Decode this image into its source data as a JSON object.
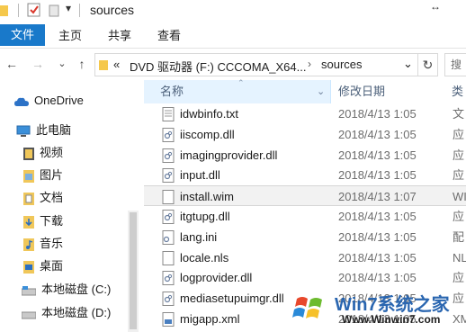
{
  "window": {
    "title": "sources",
    "resize_glyph": "↔"
  },
  "ribbon": {
    "tabs": [
      {
        "label": "文件"
      },
      {
        "label": "主页"
      },
      {
        "label": "共享"
      },
      {
        "label": "查看"
      }
    ]
  },
  "address": {
    "overflow": "«",
    "crumbs": [
      "DVD 驱动器 (F:) CCCOMA_X64...",
      "sources"
    ],
    "separator": "›",
    "dropdown": "⌄",
    "refresh": "↻",
    "search_placeholder": "搜"
  },
  "nav": {
    "items": [
      {
        "label": "OneDrive",
        "icon": "cloud-icon"
      },
      {
        "label": "此电脑",
        "icon": "computer-icon"
      },
      {
        "label": "视频",
        "icon": "video-folder-icon"
      },
      {
        "label": "图片",
        "icon": "pictures-folder-icon"
      },
      {
        "label": "文档",
        "icon": "documents-folder-icon"
      },
      {
        "label": "下载",
        "icon": "downloads-folder-icon"
      },
      {
        "label": "音乐",
        "icon": "music-folder-icon"
      },
      {
        "label": "桌面",
        "icon": "desktop-folder-icon"
      },
      {
        "label": "本地磁盘 (C:)",
        "icon": "drive-icon"
      },
      {
        "label": "本地磁盘 (D:)",
        "icon": "drive-icon"
      }
    ]
  },
  "columns": {
    "name": "名称",
    "date": "修改日期",
    "type": "类"
  },
  "files": [
    {
      "name": "idwbinfo.txt",
      "date": "2018/4/13 1:05",
      "type": "文",
      "icon": "text-file-icon"
    },
    {
      "name": "iiscomp.dll",
      "date": "2018/4/13 1:05",
      "type": "应",
      "icon": "dll-file-icon"
    },
    {
      "name": "imagingprovider.dll",
      "date": "2018/4/13 1:05",
      "type": "应",
      "icon": "dll-file-icon"
    },
    {
      "name": "input.dll",
      "date": "2018/4/13 1:05",
      "type": "应",
      "icon": "dll-file-icon"
    },
    {
      "name": "install.wim",
      "date": "2018/4/13 1:07",
      "type": "WI",
      "icon": "wim-file-icon",
      "selected": true
    },
    {
      "name": "itgtupg.dll",
      "date": "2018/4/13 1:05",
      "type": "应",
      "icon": "dll-file-icon"
    },
    {
      "name": "lang.ini",
      "date": "2018/4/13 1:05",
      "type": "配",
      "icon": "ini-file-icon"
    },
    {
      "name": "locale.nls",
      "date": "2018/4/13 1:05",
      "type": "NL",
      "icon": "nls-file-icon"
    },
    {
      "name": "logprovider.dll",
      "date": "2018/4/13 1:05",
      "type": "应",
      "icon": "dll-file-icon"
    },
    {
      "name": "mediasetupuimgr.dll",
      "date": "2018/4/13 1:05",
      "type": "应",
      "icon": "dll-file-icon"
    },
    {
      "name": "migapp.xml",
      "date": "2018/4/13 1:05",
      "type": "XM",
      "icon": "xml-file-icon"
    }
  ],
  "watermark": {
    "brand": "Win7系统之家",
    "url": "Www.Winwin7.com"
  }
}
